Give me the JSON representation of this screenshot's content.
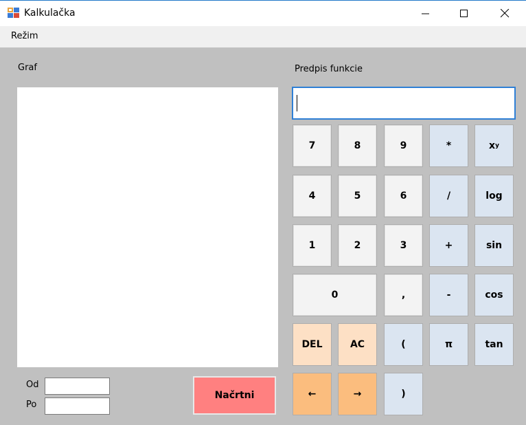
{
  "window": {
    "title": "Kalkulačka"
  },
  "menu": {
    "items": [
      "Režim"
    ]
  },
  "graph": {
    "label": "Graf"
  },
  "function": {
    "label": "Predpis funkcie",
    "value": ""
  },
  "range": {
    "from_label": "Od",
    "to_label": "Po",
    "from_value": "",
    "to_value": ""
  },
  "draw_button": "Načrtni",
  "keys": {
    "k7": "7",
    "k8": "8",
    "k9": "9",
    "mul": "*",
    "pow_base": "x",
    "pow_exp": "y",
    "k4": "4",
    "k5": "5",
    "k6": "6",
    "div": "/",
    "log": "log",
    "k1": "1",
    "k2": "2",
    "k3": "3",
    "plus": "+",
    "sin": "sin",
    "k0": "0",
    "comma": ",",
    "minus": "-",
    "cos": "cos",
    "del": "DEL",
    "ac": "AC",
    "lparen": "(",
    "pi": "π",
    "tan": "tan",
    "left": "←",
    "right": "→",
    "rparen": ")"
  },
  "colors": {
    "accent": "#2e7fd6",
    "draw": "#ff8080",
    "op": "#dbe5f1",
    "del": "#fde0c5",
    "arrow": "#fbbd7e"
  }
}
